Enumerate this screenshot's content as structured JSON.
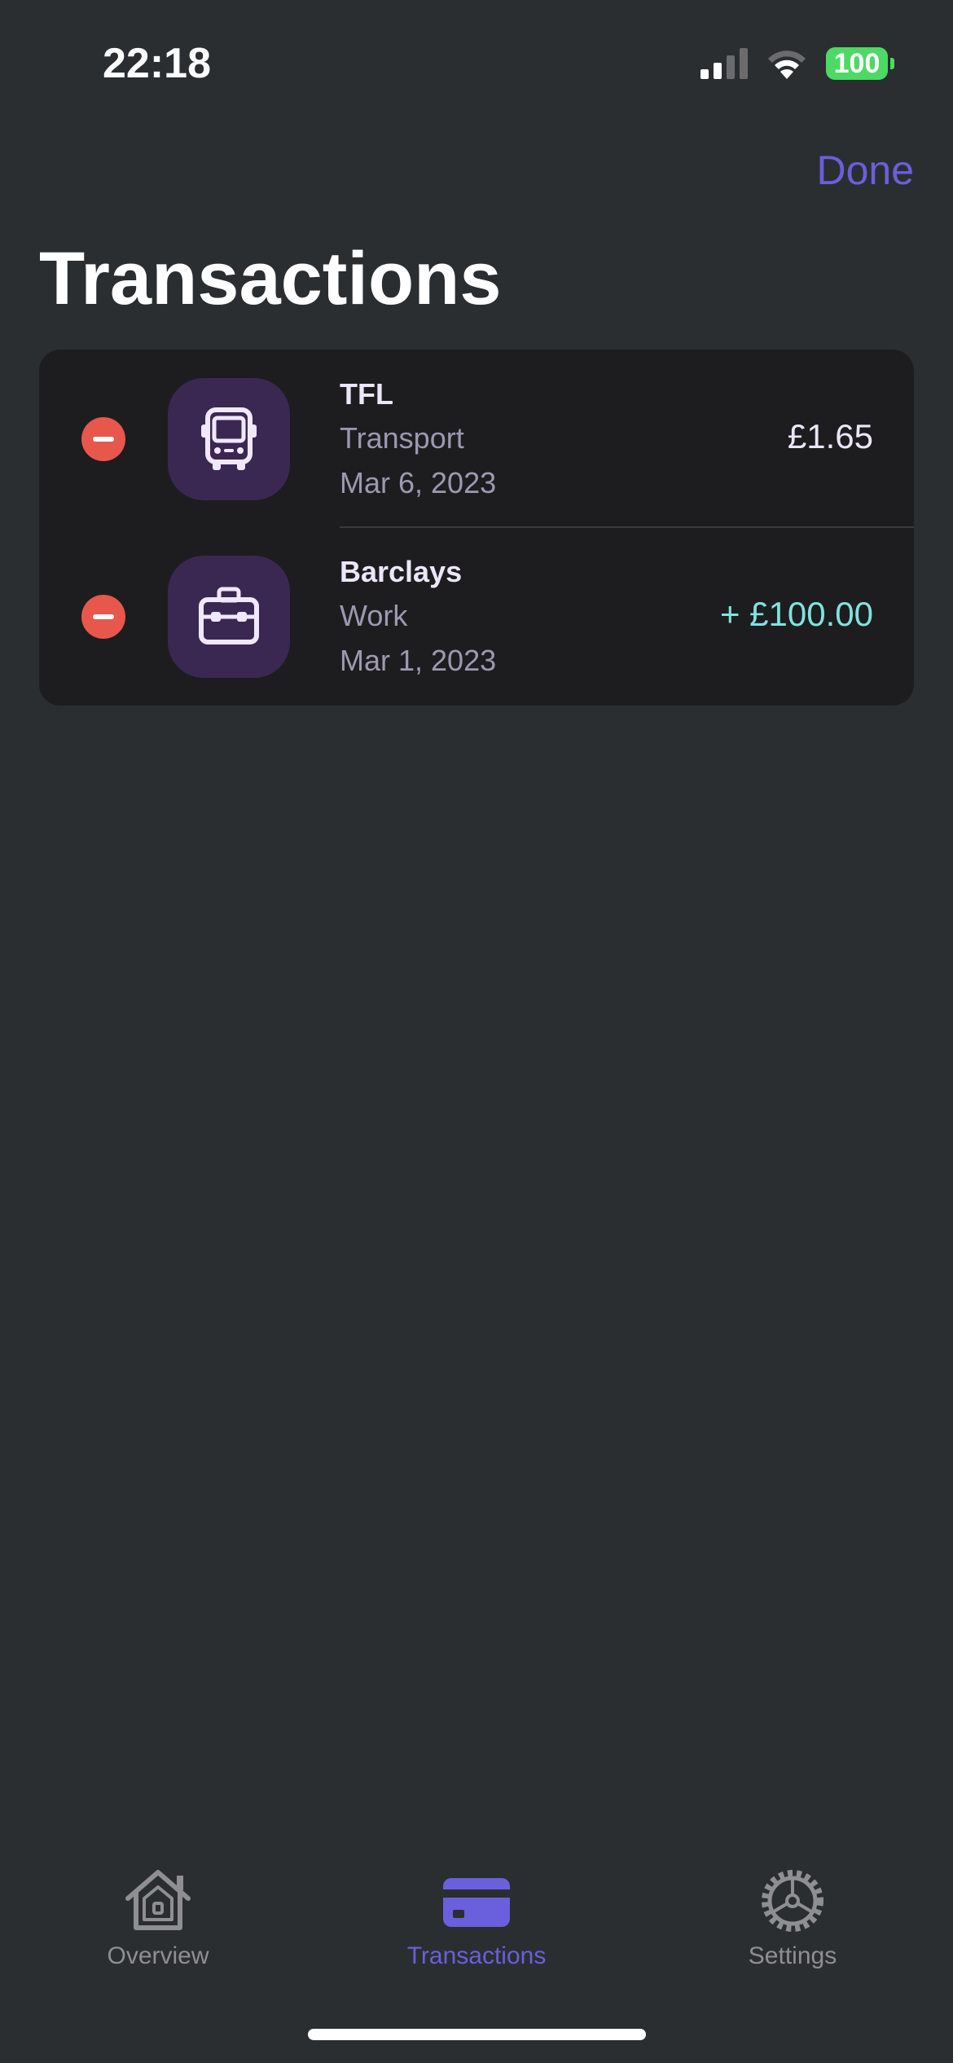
{
  "status_bar": {
    "time": "22:18",
    "battery": "100"
  },
  "nav": {
    "done_label": "Done",
    "title": "Transactions"
  },
  "transactions": [
    {
      "name": "TFL",
      "category": "Transport",
      "date": "Mar 6, 2023",
      "amount": "£1.65",
      "icon": "bus-icon"
    },
    {
      "name": "Barclays",
      "category": "Work",
      "date": "Mar 1, 2023",
      "amount": "+ £100.00",
      "icon": "briefcase-icon"
    }
  ],
  "tab_bar": {
    "tabs": [
      {
        "label": "Overview",
        "icon": "house-icon"
      },
      {
        "label": "Transactions",
        "icon": "credit-card-icon"
      },
      {
        "label": "Settings",
        "icon": "gear-icon"
      }
    ],
    "selected": "Transactions"
  },
  "colors": {
    "accent": "#6a5fdc",
    "delete": "#e8574b",
    "income": "#7fe3e0",
    "background": "#2b2e30",
    "card": "#1d1d1f",
    "icon_background": "#3a2853"
  }
}
